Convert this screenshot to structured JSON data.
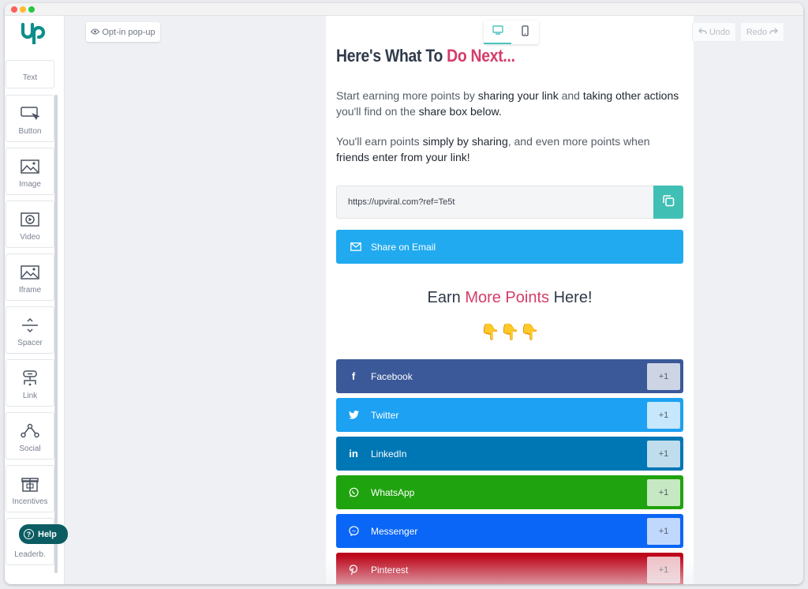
{
  "colors": {
    "brand": "#0c8f8a",
    "accent": "#d63c69",
    "copy": "#40c0b5",
    "email": "#21aaf0"
  },
  "toolbar": {
    "optin_label": "Opt-in pop-up",
    "undo_label": "Undo",
    "redo_label": "Redo"
  },
  "palette": {
    "items": [
      {
        "label": "Text",
        "icon": "text-icon"
      },
      {
        "label": "Button",
        "icon": "cursor-icon"
      },
      {
        "label": "Image",
        "icon": "image-icon"
      },
      {
        "label": "Video",
        "icon": "video-icon"
      },
      {
        "label": "Iframe",
        "icon": "iframe-icon"
      },
      {
        "label": "Spacer",
        "icon": "spacer-icon"
      },
      {
        "label": "Link",
        "icon": "link-icon"
      },
      {
        "label": "Social",
        "icon": "social-icon"
      },
      {
        "label": "Incentives",
        "icon": "gift-icon"
      },
      {
        "label": "Leaderb.",
        "icon": "leaderboard-icon"
      }
    ]
  },
  "help": {
    "label": "Help"
  },
  "content": {
    "heading_start": "Here's What To ",
    "heading_accent": "Do Next...",
    "p1": {
      "a": "Start earning more points by ",
      "b": "sharing your link",
      "c": " and ",
      "d": "taking other actions",
      "e": " you'll find on the ",
      "f": "share box below."
    },
    "p2": {
      "a": "You'll earn points ",
      "b": "simply by sharing",
      "c": ", and even more points when ",
      "d": "friends enter from your link!"
    },
    "share_link": "https://upviral.com?ref=Te5t",
    "email_label": "Share on Email",
    "earn_title_a": "Earn ",
    "earn_title_accent": "More Points",
    "earn_title_b": " Here!",
    "emojis": "👇👇👇"
  },
  "social_buttons": [
    {
      "label": "Facebook",
      "points": "+1",
      "color": "#3b5998",
      "icon": "facebook-icon",
      "glyph": "f"
    },
    {
      "label": "Twitter",
      "points": "+1",
      "color": "#1da1f2",
      "icon": "twitter-icon",
      "glyph": "🐦"
    },
    {
      "label": "LinkedIn",
      "points": "+1",
      "color": "#0077b5",
      "icon": "linkedin-icon",
      "glyph": "in"
    },
    {
      "label": "WhatsApp",
      "points": "+1",
      "color": "#1fa30e",
      "icon": "whatsapp-icon",
      "glyph": "◎"
    },
    {
      "label": "Messenger",
      "points": "+1",
      "color": "#0a66f6",
      "icon": "messenger-icon",
      "glyph": "⚡"
    },
    {
      "label": "Pinterest",
      "points": "+1",
      "color": "#bd081c",
      "icon": "pinterest-icon",
      "glyph": "P"
    }
  ]
}
